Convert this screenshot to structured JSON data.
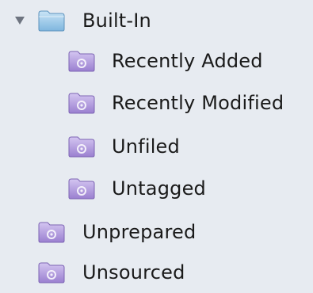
{
  "source_list": {
    "items": [
      {
        "label": "Built-In",
        "icon": "folder-icon",
        "expanded": true,
        "level": 0
      },
      {
        "label": "Recently Added",
        "icon": "smart-folder-icon",
        "level": 1
      },
      {
        "label": "Recently Modified",
        "icon": "smart-folder-icon",
        "level": 1
      },
      {
        "label": "Unfiled",
        "icon": "smart-folder-icon",
        "level": 1
      },
      {
        "label": "Untagged",
        "icon": "smart-folder-icon",
        "level": 1
      },
      {
        "label": "Unprepared",
        "icon": "smart-folder-icon",
        "level": 0
      },
      {
        "label": "Unsourced",
        "icon": "smart-folder-icon",
        "level": 0
      }
    ]
  },
  "colors": {
    "background": "#e7ebf1",
    "folder_blue": "#8fc2e6",
    "smart_folder_purple": "#a78fd8"
  }
}
